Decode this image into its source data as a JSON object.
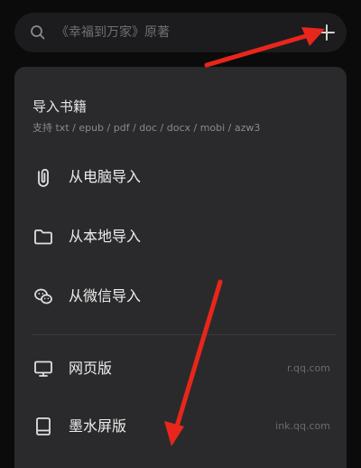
{
  "search": {
    "placeholder": "《幸福到万家》原著"
  },
  "menu": {
    "title": "导入书籍",
    "subtitle": "支持 txt / epub / pdf / doc / docx / mobi / azw3",
    "items": [
      {
        "label": "从电脑导入",
        "icon": "paperclip-icon"
      },
      {
        "label": "从本地导入",
        "icon": "folder-icon"
      },
      {
        "label": "从微信导入",
        "icon": "wechat-icon"
      },
      {
        "label": "网页版",
        "icon": "monitor-icon",
        "url": "r.qq.com"
      },
      {
        "label": "墨水屏版",
        "icon": "ereader-icon",
        "url": "ink.qq.com"
      }
    ]
  },
  "colors": {
    "background": "#0b0b0b",
    "panel": "#2a2a2c",
    "search_bar": "#1c1c1e",
    "annotation_arrow": "#e8261b"
  }
}
